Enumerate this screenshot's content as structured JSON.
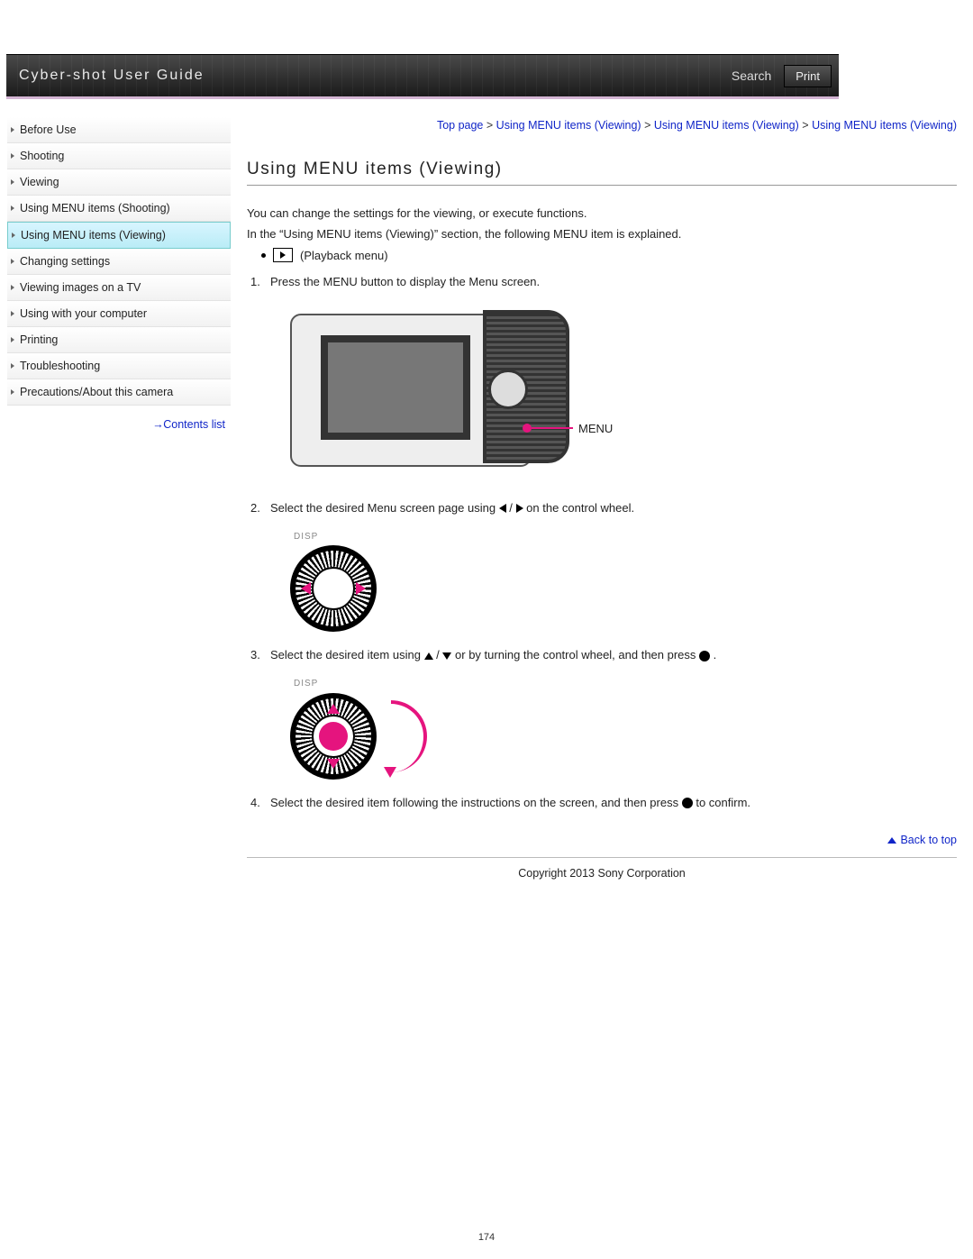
{
  "header": {
    "title": "Cyber-shot User Guide",
    "search_label": "Search",
    "print_label": "Print"
  },
  "sidebar": {
    "items": [
      {
        "label": "Before Use",
        "active": false
      },
      {
        "label": "Shooting",
        "active": false
      },
      {
        "label": "Viewing",
        "active": false
      },
      {
        "label": "Using MENU items (Shooting)",
        "active": false
      },
      {
        "label": "Using MENU items (Viewing)",
        "active": true
      },
      {
        "label": "Changing settings",
        "active": false
      },
      {
        "label": "Viewing images on a TV",
        "active": false
      },
      {
        "label": "Using with your computer",
        "active": false
      },
      {
        "label": "Printing",
        "active": false
      },
      {
        "label": "Troubleshooting",
        "active": false
      },
      {
        "label": "Precautions/About this camera",
        "active": false
      }
    ],
    "contents_list_label": "Contents list"
  },
  "breadcrumb": {
    "items": [
      "Top page",
      "Using MENU items (Viewing)",
      "Using MENU items (Viewing)",
      "Using MENU items (Viewing)"
    ],
    "sep": ">"
  },
  "article": {
    "title": "Using MENU items (Viewing)",
    "intro1": "You can change the settings for the viewing, or execute functions.",
    "intro2": "In the “Using MENU items (Viewing)” section, the following MENU item is explained.",
    "playback_label": "(Playback menu)",
    "menu_callout": "MENU",
    "steps": {
      "s1": "Press the MENU button to display the Menu screen.",
      "s2_pre": "Select the desired Menu screen page using ",
      "s2_mid": " / ",
      "s2_post": " on the control wheel.",
      "s3_pre": "Select the desired item using ",
      "s3_mid": " / ",
      "s3_post1": " or by turning the control wheel, and then press ",
      "s3_post2": " .",
      "s4_pre": "Select the desired item following the instructions on the screen, and then press ",
      "s4_post": " to confirm."
    },
    "disp_label": "DISP"
  },
  "footer": {
    "back_to_top": "Back to top",
    "copyright": "Copyright 2013 Sony Corporation",
    "page_number": "174"
  }
}
